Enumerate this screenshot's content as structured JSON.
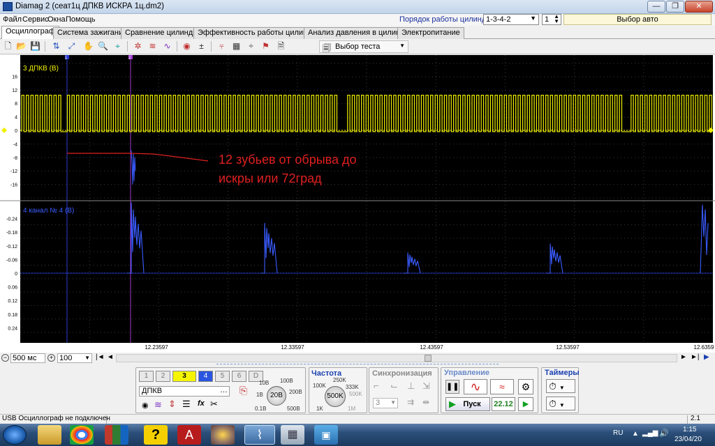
{
  "window": {
    "title": "Diamag 2 (сеат1ц ДПКВ ИСКРА 1ц.dm2)",
    "buttons": {
      "minimize": "—",
      "restore": "❐",
      "close": "✕"
    }
  },
  "menu": [
    "Файл",
    "Сервис",
    "Окна",
    "Помощь"
  ],
  "cylinder_order": {
    "label": "Порядок работы цилиндров",
    "value": "1-3-4-2",
    "spin_value": "1",
    "auto_select": "Выбор авто"
  },
  "tabs": [
    "Осциллограф",
    "Система зажигания",
    "Сравнение цилиндров",
    "Эффективность работы цилиндров",
    "Анализ давления в цилиндре",
    "Электропитание"
  ],
  "toolbar": {
    "test_select": "Выбор теста",
    "auto_label": "AUTO"
  },
  "channel3": {
    "label": "3 ДПКВ (В)",
    "color": "#f0f000",
    "ticks": [
      "16",
      "12",
      "8",
      "4",
      "0",
      "-4",
      "-8",
      "-12",
      "-16"
    ]
  },
  "channel4": {
    "label": "4  канал № 4 (В)",
    "color": "#3a5cff",
    "ticks": [
      "-0.24",
      "-0.18",
      "-0.12",
      "-0.06",
      "0",
      "0.06",
      "0.12",
      "0.18",
      "0.24"
    ]
  },
  "annotation": {
    "line1": "12 зубьев от обрыва до",
    "line2": "искры или 72град",
    "color": "#e02020"
  },
  "time_axis": [
    "12.23597",
    "12.33597",
    "12.43597",
    "12.53597",
    "12.6359"
  ],
  "markers": [
    "1",
    "2"
  ],
  "scale": {
    "time": "500 мс",
    "zoom": "100"
  },
  "channels_panel": {
    "buttons": [
      "1",
      "2",
      "3",
      "4",
      "5",
      "6",
      "D"
    ],
    "selected_channel": "ДПКВ",
    "voltage_knob": "20В",
    "voltage_marks": [
      "10В",
      "100В",
      "1В",
      "200В",
      "0.1В",
      "500В"
    ]
  },
  "frequency": {
    "title": "Частота",
    "knob": "500K",
    "marks": [
      "250K",
      "100K",
      "333K",
      "500K",
      "1K",
      "1M"
    ]
  },
  "sync": {
    "title": "Синхронизация",
    "value": "3"
  },
  "control": {
    "title": "Управление",
    "start": "Пуск",
    "version": "22.12"
  },
  "timers": {
    "title": "Таймеры"
  },
  "status": {
    "text": "USB Осциллограф не подключен",
    "version": "2.1"
  },
  "taskbar": {
    "lang": "RU",
    "time": "1:15",
    "date": "23/04/20"
  }
}
